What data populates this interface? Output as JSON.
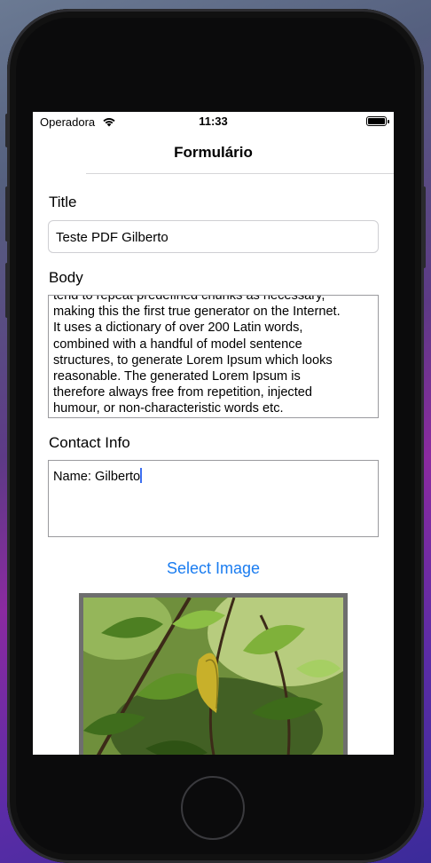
{
  "status_bar": {
    "carrier": "Operadora",
    "time": "11:33",
    "wifi_icon": "wifi-icon",
    "battery_icon": "battery-icon"
  },
  "nav": {
    "title": "Formulário"
  },
  "form": {
    "title_label": "Title",
    "title_value": "Teste PDF Gilberto",
    "body_label": "Body",
    "body_lines": [
      "tend to repeat predefined chunks as necessary,",
      "making this the first true generator on the Internet.",
      "It uses a dictionary of over 200 Latin words,",
      "combined with a handful of model sentence",
      "structures, to generate Lorem Ipsum which looks",
      "reasonable. The generated Lorem Ipsum is",
      "therefore always free from repetition, injected",
      "humour, or non-characteristic words etc."
    ],
    "contact_label": "Contact Info",
    "contact_value": "Name: Gilberto",
    "select_image_label": "Select Image"
  },
  "colors": {
    "accent": "#1a7cf0",
    "caret": "#3d6ff0"
  }
}
